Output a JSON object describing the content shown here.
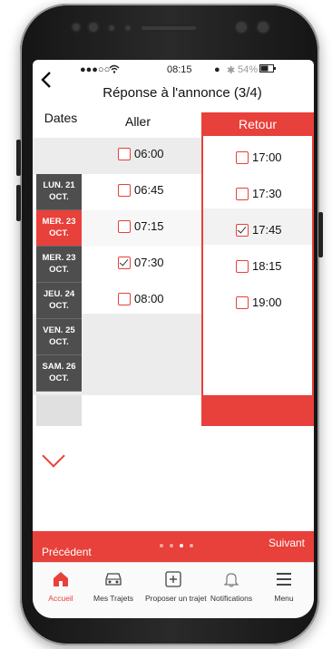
{
  "status": {
    "carrier": "●●●○○",
    "wifi": "WiFi",
    "time": "08:15",
    "battery": "54%"
  },
  "header": {
    "back_label": "<",
    "title": "Réponse à l'annonce (3/4)"
  },
  "columns": {
    "dates": "Dates",
    "aller": "Aller",
    "retour": "Retour"
  },
  "dates": [
    {
      "line1": "LUN. 21",
      "line2": "OCT.",
      "active": false
    },
    {
      "line1": "MER. 23",
      "line2": "OCT.",
      "active": true
    },
    {
      "line1": "MER. 23",
      "line2": "OCT.",
      "active": false
    },
    {
      "line1": "JEU. 24",
      "line2": "OCT.",
      "active": false
    },
    {
      "line1": "VEN. 25",
      "line2": "OCT.",
      "active": false
    },
    {
      "line1": "SAM. 26",
      "line2": "OCT.",
      "active": false
    }
  ],
  "aller_times": [
    {
      "time": "06:00",
      "checked": false
    },
    {
      "time": "06:45",
      "checked": false
    },
    {
      "time": "07:15",
      "checked": false
    },
    {
      "time": "07:30",
      "checked": true
    },
    {
      "time": "08:00",
      "checked": false
    }
  ],
  "retour_times": [
    {
      "time": "17:00",
      "checked": false
    },
    {
      "time": "17:30",
      "checked": false
    },
    {
      "time": "17:45",
      "checked": true
    },
    {
      "time": "18:15",
      "checked": false
    },
    {
      "time": "19:00",
      "checked": false
    }
  ],
  "footer": {
    "prev": "Précédent",
    "next": "Suivant",
    "page_count": 4,
    "current_page": 3
  },
  "tabs": [
    {
      "label": "Accueil",
      "icon": "home-icon",
      "active": true
    },
    {
      "label": "Mes Trajets",
      "icon": "car-icon",
      "active": false
    },
    {
      "label": "Proposer un trajet",
      "icon": "plus-box-icon",
      "active": false
    },
    {
      "label": "Notifications",
      "icon": "bell-icon",
      "active": false
    },
    {
      "label": "Menu",
      "icon": "menu-icon",
      "active": false
    }
  ],
  "colors": {
    "accent": "#e8403a",
    "date_bg": "#4e4e4e"
  }
}
